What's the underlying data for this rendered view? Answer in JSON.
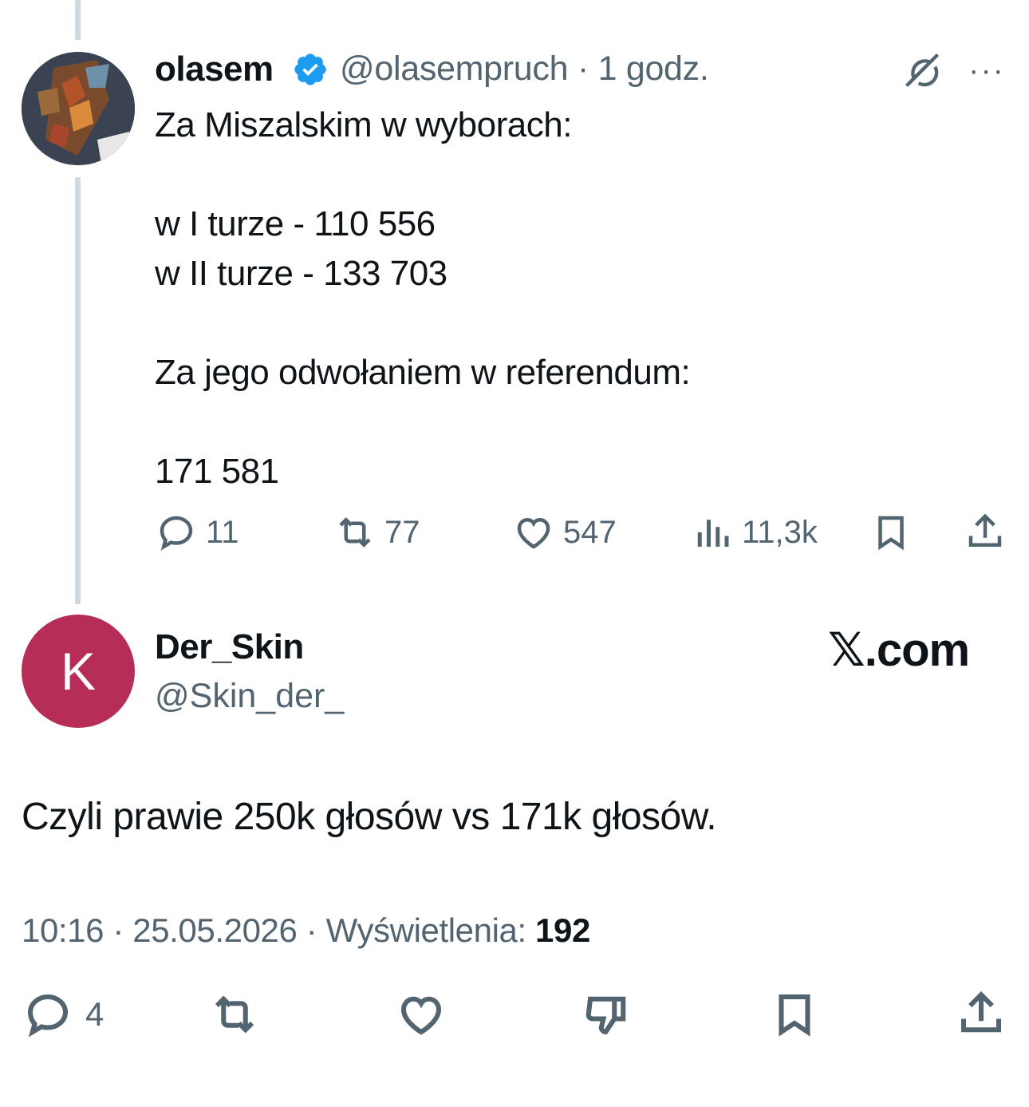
{
  "tweet1": {
    "display_name": "olasem",
    "handle": "@olasempruch",
    "time": "1 godz.",
    "lines": [
      "Za Miszalskim w wyborach:",
      "",
      "w I turze - 110 556",
      "w II turze - 133 703",
      "",
      "Za jego odwołaniem w referendum:",
      "",
      "171 581"
    ],
    "replies": "11",
    "reposts": "77",
    "likes": "547",
    "views": "11,3k"
  },
  "tweet2": {
    "avatar_letter": "K",
    "display_name": "Der_Skin",
    "handle": "@Skin_der_",
    "brand": "𝕏.com",
    "text": "Czyli prawie 250k głosów vs 171k głosów.",
    "time": "10:16",
    "date": "25.05.2026",
    "views_label": "Wyświetlenia:",
    "views": "192",
    "replies": "4"
  },
  "colors": {
    "secondary_text": "#536471",
    "avatar_bg": "#b62e57",
    "verified": "#1d9bf0",
    "thread_line": "#cfd9de"
  },
  "icons": [
    "verified-badge-icon",
    "grok-icon",
    "more-icon",
    "reply-icon",
    "repost-icon",
    "like-icon",
    "views-icon",
    "bookmark-icon",
    "share-icon",
    "dislike-icon"
  ]
}
